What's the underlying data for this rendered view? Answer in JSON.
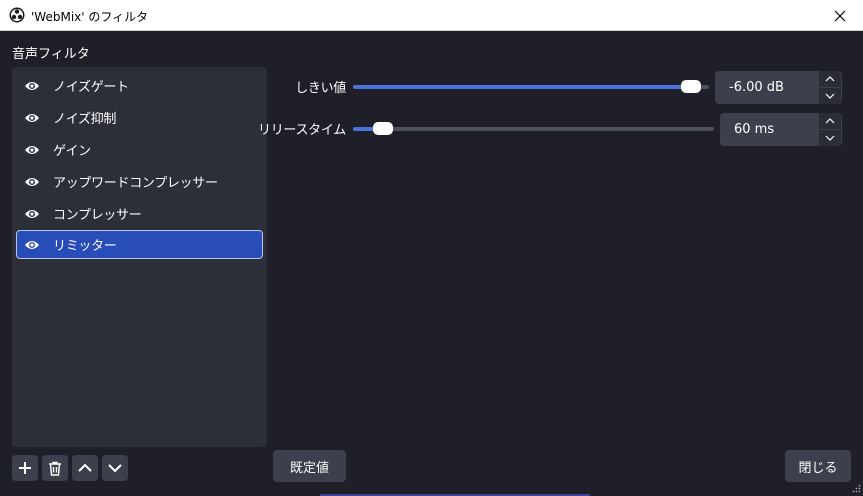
{
  "window": {
    "title": "'WebMix' のフィルタ",
    "app_icon": "obs-logo-icon",
    "close_icon": "close-icon"
  },
  "filters": {
    "section_label": "音声フィルタ",
    "items": [
      {
        "label": "ノイズゲート",
        "visible": true,
        "selected": false
      },
      {
        "label": "ノイズ抑制",
        "visible": true,
        "selected": false
      },
      {
        "label": "ゲイン",
        "visible": true,
        "selected": false
      },
      {
        "label": "アップワードコンプレッサー",
        "visible": true,
        "selected": false
      },
      {
        "label": "コンプレッサー",
        "visible": true,
        "selected": false
      },
      {
        "label": "リミッター",
        "visible": true,
        "selected": true
      }
    ],
    "toolbar_icons": [
      "plus-icon",
      "trash-icon",
      "chevron-up-icon",
      "chevron-down-icon"
    ]
  },
  "properties": {
    "threshold": {
      "label": "しきい値",
      "value": "-6.00 dB",
      "slider_fraction": 0.975
    },
    "release": {
      "label": "リリースタイム",
      "value": "60 ms",
      "slider_fraction": 0.06
    }
  },
  "buttons": {
    "defaults": "既定値",
    "close": "閉じる"
  },
  "colors": {
    "selection": "#284cb8",
    "slider_fill": "#4a73dc",
    "background": "#1e1f29",
    "panel": "#2c2e38",
    "control": "#3c404d"
  }
}
